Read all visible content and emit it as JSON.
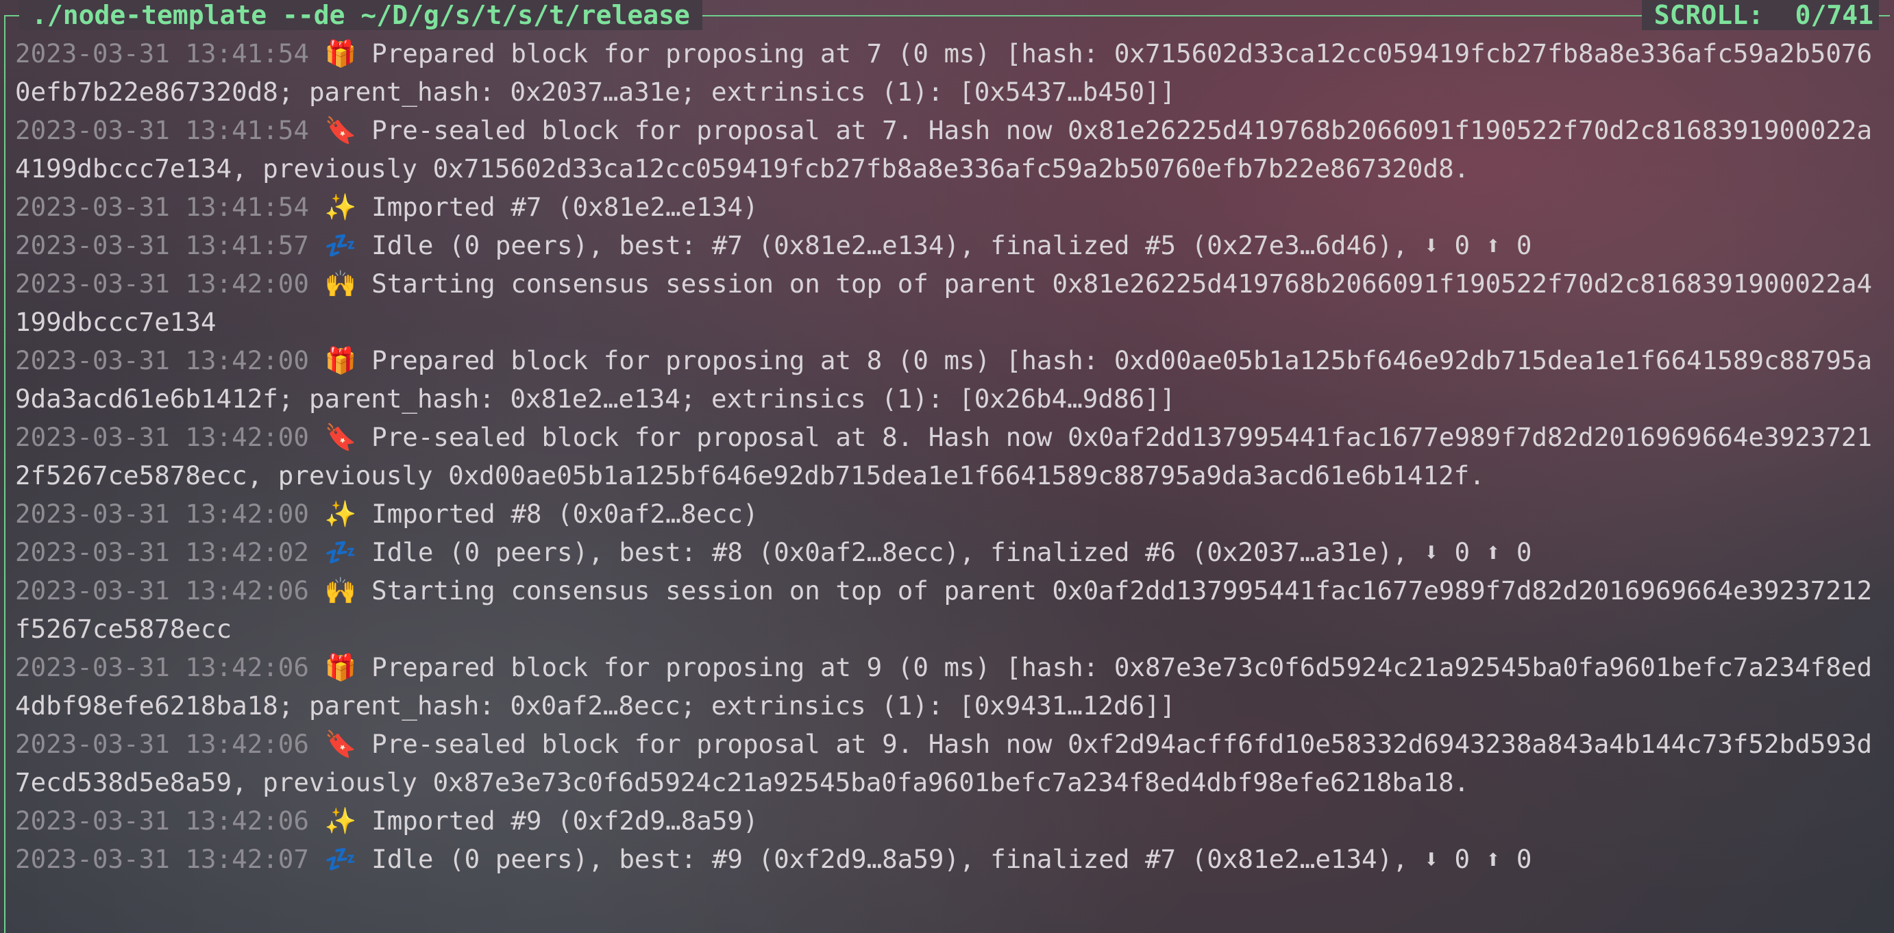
{
  "window": {
    "title": "./node-template --de ~/D/g/s/t/s/t/release",
    "scroll_label": "SCROLL:",
    "scroll_value": "0/741"
  },
  "icons": {
    "gift": "gift-icon",
    "stamp": "stamp-icon",
    "sparkles": "sparkles-icon",
    "zzz": "zzz-icon",
    "raised_hands": "raised-hands-icon",
    "arrow_down": "download-arrow-icon",
    "arrow_up": "upload-arrow-icon"
  },
  "lines": [
    {
      "ts": "2023-03-31 13:41:54",
      "icon": "gift",
      "glyph": "🎁",
      "text": "Prepared block for proposing at 7 (0 ms) [hash: 0x715602d33ca12cc059419fcb27fb8a8e336afc59a2b50760efb7b22e867320d8; parent_hash: 0x2037…a31e; extrinsics (1): [0x5437…b450]]"
    },
    {
      "ts": "2023-03-31 13:41:54",
      "icon": "stamp",
      "glyph": "🔖",
      "text": "Pre-sealed block for proposal at 7. Hash now 0x81e26225d419768b2066091f190522f70d2c8168391900022a4199dbccc7e134, previously 0x715602d33ca12cc059419fcb27fb8a8e336afc59a2b50760efb7b22e867320d8."
    },
    {
      "ts": "2023-03-31 13:41:54",
      "icon": "sparkles",
      "glyph": "✨",
      "text": "Imported #7 (0x81e2…e134)"
    },
    {
      "ts": "2023-03-31 13:41:57",
      "icon": "zzz",
      "glyph": "💤",
      "text": "Idle (0 peers), best: #7 (0x81e2…e134), finalized #5 (0x27e3…6d46), ⬇ 0 ⬆ 0"
    },
    {
      "ts": "2023-03-31 13:42:00",
      "icon": "raised_hands",
      "glyph": "🙌",
      "text": "Starting consensus session on top of parent 0x81e26225d419768b2066091f190522f70d2c8168391900022a4199dbccc7e134"
    },
    {
      "ts": "2023-03-31 13:42:00",
      "icon": "gift",
      "glyph": "🎁",
      "text": "Prepared block for proposing at 8 (0 ms) [hash: 0xd00ae05b1a125bf646e92db715dea1e1f6641589c88795a9da3acd61e6b1412f; parent_hash: 0x81e2…e134; extrinsics (1): [0x26b4…9d86]]"
    },
    {
      "ts": "2023-03-31 13:42:00",
      "icon": "stamp",
      "glyph": "🔖",
      "text": "Pre-sealed block for proposal at 8. Hash now 0x0af2dd137995441fac1677e989f7d82d2016969664e39237212f5267ce5878ecc, previously 0xd00ae05b1a125bf646e92db715dea1e1f6641589c88795a9da3acd61e6b1412f."
    },
    {
      "ts": "2023-03-31 13:42:00",
      "icon": "sparkles",
      "glyph": "✨",
      "text": "Imported #8 (0x0af2…8ecc)"
    },
    {
      "ts": "2023-03-31 13:42:02",
      "icon": "zzz",
      "glyph": "💤",
      "text": "Idle (0 peers), best: #8 (0x0af2…8ecc), finalized #6 (0x2037…a31e), ⬇ 0 ⬆ 0"
    },
    {
      "ts": "2023-03-31 13:42:06",
      "icon": "raised_hands",
      "glyph": "🙌",
      "text": "Starting consensus session on top of parent 0x0af2dd137995441fac1677e989f7d82d2016969664e39237212f5267ce5878ecc"
    },
    {
      "ts": "2023-03-31 13:42:06",
      "icon": "gift",
      "glyph": "🎁",
      "text": "Prepared block for proposing at 9 (0 ms) [hash: 0x87e3e73c0f6d5924c21a92545ba0fa9601befc7a234f8ed4dbf98efe6218ba18; parent_hash: 0x0af2…8ecc; extrinsics (1): [0x9431…12d6]]"
    },
    {
      "ts": "2023-03-31 13:42:06",
      "icon": "stamp",
      "glyph": "🔖",
      "text": "Pre-sealed block for proposal at 9. Hash now 0xf2d94acff6fd10e58332d6943238a843a4b144c73f52bd593d7ecd538d5e8a59, previously 0x87e3e73c0f6d5924c21a92545ba0fa9601befc7a234f8ed4dbf98efe6218ba18."
    },
    {
      "ts": "2023-03-31 13:42:06",
      "icon": "sparkles",
      "glyph": "✨",
      "text": "Imported #9 (0xf2d9…8a59)"
    },
    {
      "ts": "2023-03-31 13:42:07",
      "icon": "zzz",
      "glyph": "💤",
      "text": "Idle (0 peers), best: #9 (0xf2d9…8a59), finalized #7 (0x81e2…e134), ⬇ 0 ⬆ 0"
    }
  ]
}
